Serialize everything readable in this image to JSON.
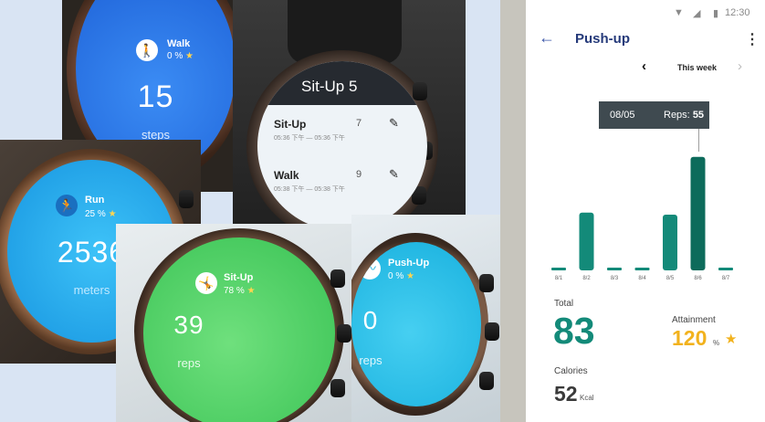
{
  "photos": {
    "walk": {
      "name": "Walk",
      "percent": "0 %",
      "value": "15",
      "unit": "steps"
    },
    "situp_list": {
      "header_title": "Sit-Up",
      "header_count": "5",
      "items": [
        {
          "name": "Sit-Up",
          "count": "7",
          "time": "05:36 下午 — 05:36 下午"
        },
        {
          "name": "Walk",
          "count": "9",
          "time": "05:38 下午 — 05:38 下午"
        }
      ]
    },
    "run": {
      "name": "Run",
      "percent": "25 %",
      "value": "2536",
      "unit": "meters"
    },
    "situp": {
      "name": "Sit-Up",
      "percent": "78 %",
      "value": "39",
      "unit": "reps"
    },
    "pushup": {
      "name": "Push-Up",
      "percent": "0 %",
      "value": "0",
      "unit": "reps"
    },
    "star_glyph": "★"
  },
  "app": {
    "status": {
      "time": "12:30",
      "wifi_icon": "▼",
      "signal_icon": "◢",
      "battery_icon": "▮"
    },
    "title": "Push-up",
    "back_glyph": "←",
    "menu_glyph": "⋮",
    "week": {
      "label": "This week",
      "prev_glyph": "‹",
      "next_glyph": "›"
    },
    "tooltip": {
      "date": "08/05",
      "reps_label": "Reps:",
      "reps_value": "55"
    },
    "stats": {
      "total_label": "Total",
      "total_value": "83",
      "attainment_label": "Attainment",
      "attainment_value": "120",
      "attainment_unit": "%",
      "attainment_star": "★",
      "calories_label": "Calories",
      "calories_value": "52",
      "calories_unit": "Kcal"
    },
    "colors": {
      "bar": "#138a79",
      "bar_selected": "#0d6b5b",
      "title": "#253a7a",
      "accent": "#f2b21d"
    }
  },
  "chart_data": {
    "type": "bar",
    "categories": [
      "8/1",
      "8/2",
      "8/3",
      "8/4",
      "8/5",
      "8/6",
      "8/7"
    ],
    "values": [
      0,
      28,
      0,
      0,
      27,
      55,
      0
    ],
    "selected": "8/6",
    "ylim": [
      0,
      58
    ]
  }
}
